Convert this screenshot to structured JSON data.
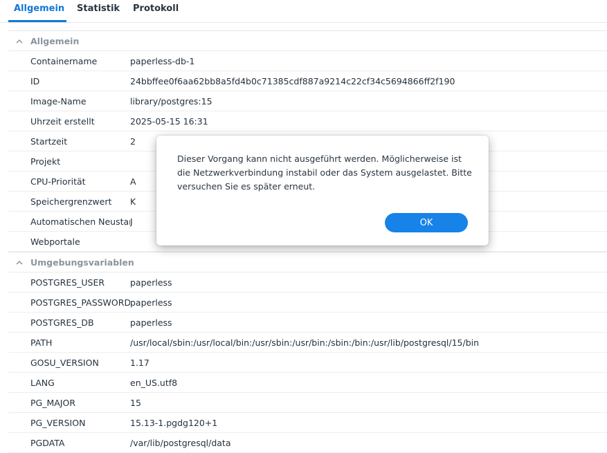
{
  "tabs": [
    {
      "label": "Allgemein",
      "active": true
    },
    {
      "label": "Statistik",
      "active": false
    },
    {
      "label": "Protokoll",
      "active": false
    }
  ],
  "sections": {
    "general": {
      "title": "Allgemein",
      "rows": [
        {
          "key": "Containername",
          "value": "paperless-db-1"
        },
        {
          "key": "ID",
          "value": "24bbffee0f6aa62bb8a5fd4b0c71385cdf887a9214c22cf34c5694866ff2f190"
        },
        {
          "key": "Image-Name",
          "value": "library/postgres:15"
        },
        {
          "key": "Uhrzeit erstellt",
          "value": "2025-05-15 16:31"
        },
        {
          "key": "Startzeit",
          "value": "2"
        },
        {
          "key": "Projekt",
          "value": ""
        },
        {
          "key": "CPU-Priorität",
          "value": "A"
        },
        {
          "key": "Speichergrenzwert",
          "value": "K"
        },
        {
          "key": "Automatischen Neustart",
          "value": "J"
        },
        {
          "key": "Webportale",
          "value": ""
        }
      ]
    },
    "env": {
      "title": "Umgebungsvariablen",
      "rows": [
        {
          "key": "POSTGRES_USER",
          "value": "paperless"
        },
        {
          "key": "POSTGRES_PASSWORD",
          "value": "paperless"
        },
        {
          "key": "POSTGRES_DB",
          "value": "paperless"
        },
        {
          "key": "PATH",
          "value": "/usr/local/sbin:/usr/local/bin:/usr/sbin:/usr/bin:/sbin:/bin:/usr/lib/postgresql/15/bin"
        },
        {
          "key": "GOSU_VERSION",
          "value": "1.17"
        },
        {
          "key": "LANG",
          "value": "en_US.utf8"
        },
        {
          "key": "PG_MAJOR",
          "value": "15"
        },
        {
          "key": "PG_VERSION",
          "value": "15.13-1.pgdg120+1"
        },
        {
          "key": "PGDATA",
          "value": "/var/lib/postgresql/data"
        }
      ]
    }
  },
  "dialog": {
    "message": "Dieser Vorgang kann nicht ausgeführt werden. Möglicherweise ist die Netzwerkverbindung instabil oder das System ausgelastet. Bitte versuchen Sie es später erneut.",
    "ok_label": "OK"
  },
  "colors": {
    "accent": "#1277d4",
    "button": "#1782e8"
  }
}
